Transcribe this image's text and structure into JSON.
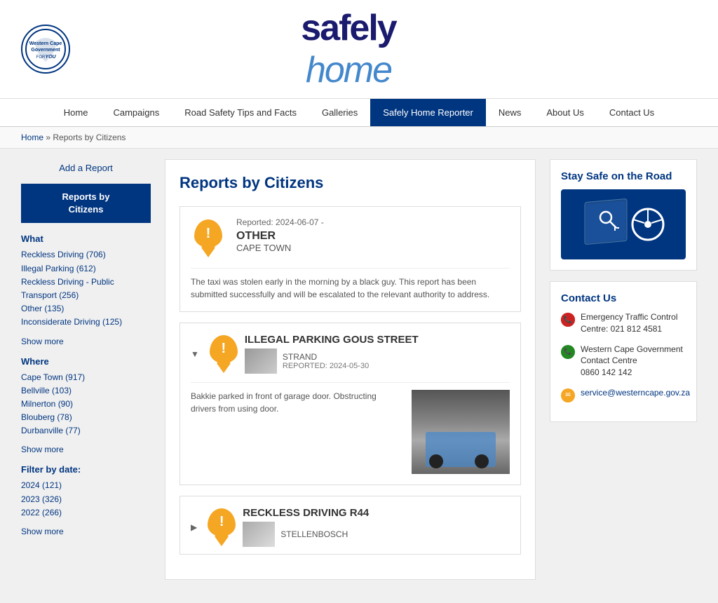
{
  "header": {
    "logo_org": "Western Cape\nGovernment",
    "logo_for": "FoR",
    "logo_you": "You",
    "site_title_safely": "safely",
    "site_title_home": "home"
  },
  "nav": {
    "items": [
      {
        "label": "Home",
        "active": false
      },
      {
        "label": "Campaigns",
        "active": false
      },
      {
        "label": "Road Safety Tips and Facts",
        "active": false
      },
      {
        "label": "Galleries",
        "active": false
      },
      {
        "label": "Safely Home Reporter",
        "active": true
      },
      {
        "label": "News",
        "active": false
      },
      {
        "label": "About Us",
        "active": false
      },
      {
        "label": "Contact Us",
        "active": false
      }
    ]
  },
  "breadcrumb": {
    "home": "Home",
    "separator": "»",
    "current": "Reports by Citizens"
  },
  "sidebar": {
    "add_report": "Add a Report",
    "reports_btn": "Reports by\nCitizens",
    "what_label": "What",
    "what_items": [
      "Reckless Driving (706)",
      "Illegal Parking (612)",
      "Reckless Driving - Public Transport (256)",
      "Other (135)",
      "Inconsiderate Driving (125)"
    ],
    "what_show_more": "Show more",
    "where_label": "Where",
    "where_items": [
      "Cape Town (917)",
      "Bellville (103)",
      "Milnerton (90)",
      "Blouberg (78)",
      "Durbanville (77)"
    ],
    "where_show_more": "Show more",
    "date_label": "Filter by date:",
    "date_items": [
      "2024 (121)",
      "2023 (326)",
      "2022 (266)"
    ],
    "date_show_more": "Show more"
  },
  "content": {
    "title": "Reports by Citizens",
    "reports": [
      {
        "date": "Reported: 2024-06-07 -",
        "type": "OTHER",
        "location": "CAPE TOWN",
        "body": "The taxi was stolen early in the morning by a black guy. This report has been submitted successfully and will be escalated to the relevant authority to address.",
        "has_image": false
      },
      {
        "title": "ILLEGAL PARKING GOUS STREET",
        "sublocation": "STRAND",
        "reported": "REPORTED: 2024-05-30",
        "body": "Bakkie parked in front of garage door. Obstructing drivers from using door.",
        "has_image": true
      },
      {
        "title": "RECKLESS DRIVING R44",
        "sublocation": "STELLENBOSCH",
        "has_image": true,
        "partial": true
      }
    ]
  },
  "right_sidebar": {
    "stay_safe_title": "Stay Safe on the Road",
    "contact_title": "Contact Us",
    "contacts": [
      {
        "color": "red",
        "label": "Emergency Traffic Control Centre: 021 812 4581"
      },
      {
        "color": "green",
        "label": "Western Cape Government Contact Centre",
        "extra": "0860 142 142"
      },
      {
        "color": "orange",
        "label": "service@westerncape.gov.za",
        "is_email": true
      }
    ]
  }
}
